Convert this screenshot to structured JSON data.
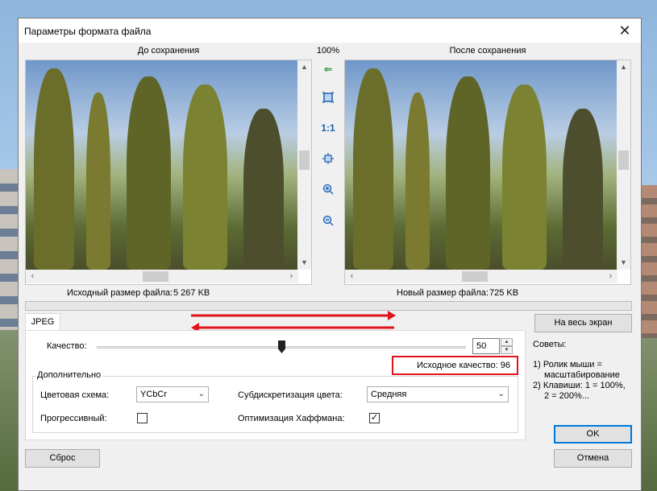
{
  "window": {
    "title": "Параметры формата файла"
  },
  "preview": {
    "before_label": "До сохранения",
    "after_label": "После сохранения",
    "zoom": "100%",
    "original_size_label": "Исходный размер файла:",
    "original_size_value": "5 267 KB",
    "new_size_label": "Новый размер файла:",
    "new_size_value": "725 KB"
  },
  "tools": {
    "fit": "fit-icon",
    "one_to_one_label": "1:1",
    "back": "back-arrow-icon",
    "center": "center-icon",
    "zoom_in": "zoom-in-icon",
    "zoom_out": "zoom-out-icon"
  },
  "tab": {
    "label": "JPEG"
  },
  "quality": {
    "label": "Качество:",
    "value": "50",
    "level": 50,
    "source_quality_label": "Исходное качество: 96"
  },
  "advanced": {
    "legend": "Дополнительно",
    "color_scheme_label": "Цветовая схема:",
    "color_scheme_value": "YCbCr",
    "subsampling_label": "Субдискретизация цвета:",
    "subsampling_value": "Средняя",
    "progressive_label": "Прогрессивный:",
    "progressive_checked": false,
    "huffman_label": "Оптимизация Хаффмана:",
    "huffman_checked": true
  },
  "buttons": {
    "fullscreen": "На весь экран",
    "reset": "Сброс",
    "ok": "OK",
    "cancel": "Отмена"
  },
  "tips": {
    "title": "Советы:",
    "line1": "1) Ролик мыши =",
    "line2": "масштабирование",
    "line3": "2) Клавиши: 1 = 100%,",
    "line4": "2 = 200%..."
  },
  "colors": {
    "accent": "#0078d7",
    "highlight": "#e0141b",
    "tool_icon": "#1d5fae"
  }
}
